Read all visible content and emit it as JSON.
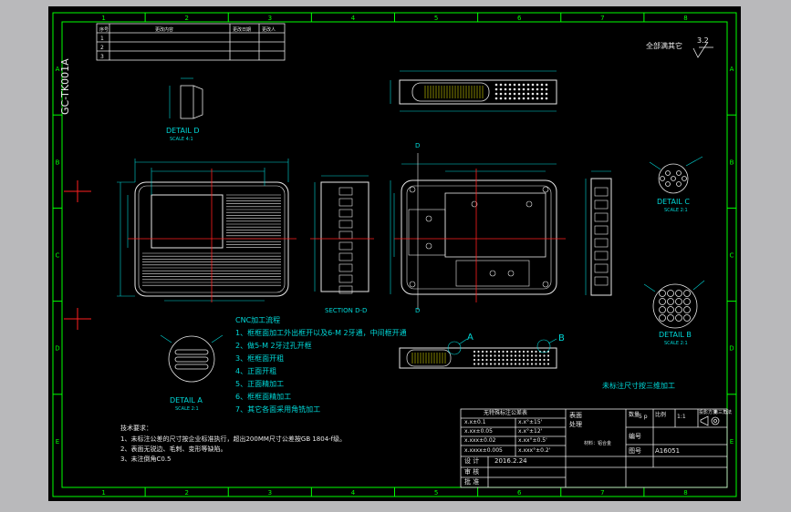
{
  "colors": {
    "frame": "#00ff00",
    "outline": "#e8e8e8",
    "dim": "#00d8d8",
    "center": "#ff2020",
    "hatch": "#d8d800",
    "bg": "#000000",
    "chrome": "#b9b9bb"
  },
  "border": {
    "top_numbers": [
      "1",
      "2",
      "3",
      "4",
      "5",
      "6",
      "7",
      "8"
    ],
    "bottom_numbers": [
      "1",
      "2",
      "3",
      "4",
      "5",
      "6",
      "7",
      "8"
    ],
    "left_letters": [
      "A",
      "B",
      "C",
      "D",
      "E"
    ],
    "right_letters": [
      "A",
      "B",
      "C",
      "D",
      "E"
    ]
  },
  "revision_table": {
    "headers": [
      "序号",
      "更改内容",
      "更改日期",
      "更改人"
    ],
    "rows": [
      "1",
      "2",
      "3"
    ]
  },
  "drawing_no": "GC-TK001A",
  "surface_roughness": {
    "label": "全部满其它",
    "value": "3.2"
  },
  "details": {
    "d": {
      "title": "DETAIL D",
      "scale": "SCALE 4:1"
    },
    "c": {
      "title": "DETAIL C",
      "scale": "SCALE 2:1"
    },
    "b": {
      "title": "DETAIL B",
      "scale": "SCALE 2:1"
    },
    "a": {
      "title": "DETAIL A",
      "scale": "SCALE 2:1"
    }
  },
  "section_dd": "SECTION D-D",
  "section_mark": "D",
  "callouts": {
    "a": "A",
    "b": "B"
  },
  "cnc_title": "CNC加工流程",
  "cnc_steps": [
    "1、框框面加工外出框开以及6-M 2牙通，中间框开通",
    "2、做5-M 2牙过孔开框",
    "3、框框面开粗",
    "4、正面开粗",
    "5、正面精加工",
    "6、框框面精加工",
    "7、其它各面采用角铣加工"
  ],
  "note_right": "未标注尺寸按三维加工",
  "tech_req": {
    "title": "技术要求：",
    "lines": [
      "1、未标注公差的尺寸按企业标准执行，超出200MM尺寸公差按GB 1804-f级。",
      "2、表面无锐边、毛刺、变形等缺陷。",
      "3、未注倒角C0.5"
    ]
  },
  "title_block": {
    "tolerance_title": "无特殊标注公差表",
    "tolerances": [
      [
        "x.x±0.1",
        "x.x°±15'"
      ],
      [
        "x.xx±0.05",
        "x.x°±12'"
      ],
      [
        "x.xxx±0.02",
        "x.xx°±0.5'"
      ],
      [
        "x.xxxx±0.005",
        "x.xxx°±0.2'"
      ]
    ],
    "surface": "表面",
    "treatment": "处理",
    "quantity_label": "数量",
    "quantity": "5 p",
    "scale_label": "比例",
    "scale": "1:1",
    "projection": "投影方法",
    "projection_type": "第三角法",
    "part_label": "编号",
    "drawing_label": "图号",
    "drawing_value": "A16051",
    "material_note": "材料：铝合金",
    "designer_label": "设 计",
    "date": "2016.2.24",
    "checker_label": "审 核",
    "approver_label": "批 准"
  }
}
